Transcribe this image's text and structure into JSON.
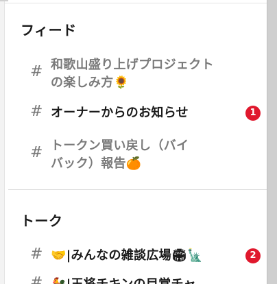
{
  "sections": [
    {
      "title": "フィード",
      "channels": [
        {
          "lines": [
            "和歌山盛り上げプロジェクト",
            "の楽しみ方"
          ],
          "emoji": "🌻",
          "unread": false,
          "badge": ""
        },
        {
          "lines": [
            "オーナーからのお知らせ"
          ],
          "emoji": "",
          "unread": true,
          "badge": "1"
        },
        {
          "lines": [
            "トークン買い戻し（バイ",
            "バック）報告"
          ],
          "emoji": "🍊",
          "unread": false,
          "badge": ""
        }
      ]
    },
    {
      "title": "トーク",
      "channels": [
        {
          "lines": [
            "🤝|みんなの雑談広場🏟🗽"
          ],
          "emoji": "",
          "unread": true,
          "badge": "2"
        },
        {
          "lines": [
            "🐓|王将チキンの目覚チャ"
          ],
          "emoji": "",
          "unread": true,
          "badge": ""
        }
      ]
    }
  ],
  "hash_symbol": "#",
  "colors": {
    "badge": "#e0182d",
    "unread_text": "#1a1a1a",
    "read_text": "#7a7a7a"
  }
}
